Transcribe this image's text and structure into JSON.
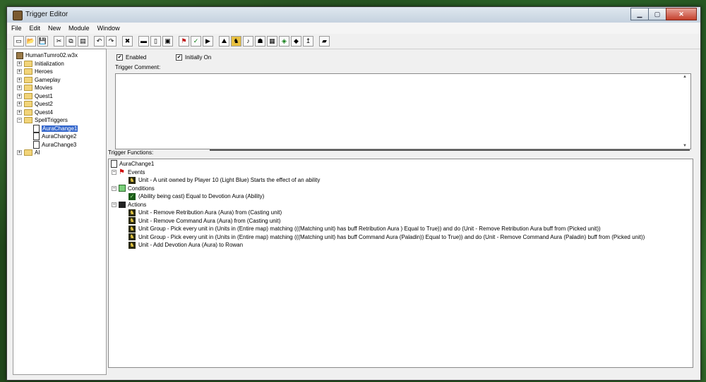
{
  "window": {
    "title": "Trigger Editor"
  },
  "menu": [
    "File",
    "Edit",
    "New",
    "Module",
    "Window"
  ],
  "toolbar": {
    "buttons": [
      {
        "icon": "new-icon",
        "glyph": "▭"
      },
      {
        "icon": "open-icon",
        "glyph": "📂"
      },
      {
        "icon": "save-icon",
        "glyph": "💾"
      },
      {
        "icon": "cut-icon",
        "glyph": "✂"
      },
      {
        "icon": "copy-icon",
        "glyph": "⧉"
      },
      {
        "icon": "paste-icon",
        "glyph": "▤"
      },
      {
        "icon": "undo-icon",
        "glyph": "↶"
      },
      {
        "icon": "redo-icon",
        "glyph": "↷"
      },
      {
        "icon": "delete-icon",
        "glyph": "✖"
      },
      {
        "icon": "new-category-icon",
        "glyph": "▬"
      },
      {
        "icon": "new-trigger-icon",
        "glyph": "▯"
      },
      {
        "icon": "new-comment-icon",
        "glyph": "▣"
      },
      {
        "icon": "new-event-icon",
        "glyph": "⚑"
      },
      {
        "icon": "new-condition-icon",
        "glyph": "✓"
      },
      {
        "icon": "new-action-icon",
        "glyph": "▶"
      },
      {
        "icon": "terrain-editor-icon",
        "glyph": "⛰"
      },
      {
        "icon": "unit-editor-icon",
        "glyph": "♞"
      },
      {
        "icon": "sound-editor-icon",
        "glyph": "♪"
      },
      {
        "icon": "object-editor-icon",
        "glyph": "☗"
      },
      {
        "icon": "campaign-editor-icon",
        "glyph": "▦"
      },
      {
        "icon": "ai-editor-icon",
        "glyph": "◈"
      },
      {
        "icon": "object-manager-icon",
        "glyph": "◆"
      },
      {
        "icon": "import-manager-icon",
        "glyph": "↥"
      },
      {
        "icon": "test-map-icon",
        "glyph": "▰"
      }
    ]
  },
  "tree": {
    "root": "HumanTumro02.w3x",
    "folders": [
      {
        "label": "Initialization",
        "expanded": false
      },
      {
        "label": "Heroes",
        "expanded": false
      },
      {
        "label": "Gameplay",
        "expanded": false
      },
      {
        "label": "Movies",
        "expanded": false
      },
      {
        "label": "Quest1",
        "expanded": false
      },
      {
        "label": "Quest2",
        "expanded": false
      },
      {
        "label": "Quest4",
        "expanded": false
      },
      {
        "label": "SpellTriggers",
        "expanded": true,
        "children": [
          "AuraChange1",
          "AuraChange2",
          "AuraChange3"
        ]
      },
      {
        "label": "AI",
        "expanded": false
      }
    ],
    "selected": "AuraChange1"
  },
  "trigger": {
    "enabled_label": "Enabled",
    "enabled": true,
    "initially_on_label": "Initially On",
    "initially_on": true,
    "comment_label": "Trigger Comment:",
    "comment": "",
    "functions_label": "Trigger Functions:"
  },
  "functions": {
    "name": "AuraChange1",
    "events_label": "Events",
    "events": [
      "Unit - A unit owned by Player 10 (Light Blue) Starts the effect of an ability"
    ],
    "conditions_label": "Conditions",
    "conditions": [
      "(Ability being cast) Equal to Devotion Aura (Ability)"
    ],
    "actions_label": "Actions",
    "actions": [
      "Unit - Remove Retribution Aura (Aura) from (Casting unit)",
      "Unit - Remove Command Aura (Aura) from (Casting unit)",
      "Unit Group - Pick every unit in (Units in (Entire map) matching (((Matching unit) has buff Retribution Aura ) Equal to True)) and do (Unit - Remove Retribution Aura  buff from (Picked unit))",
      "Unit Group - Pick every unit in (Units in (Entire map) matching (((Matching unit) has buff Command Aura (Paladin)) Equal to True)) and do (Unit - Remove Command Aura (Paladin) buff from (Picked unit))",
      "Unit - Add Devotion Aura (Aura) to Rowan"
    ]
  }
}
